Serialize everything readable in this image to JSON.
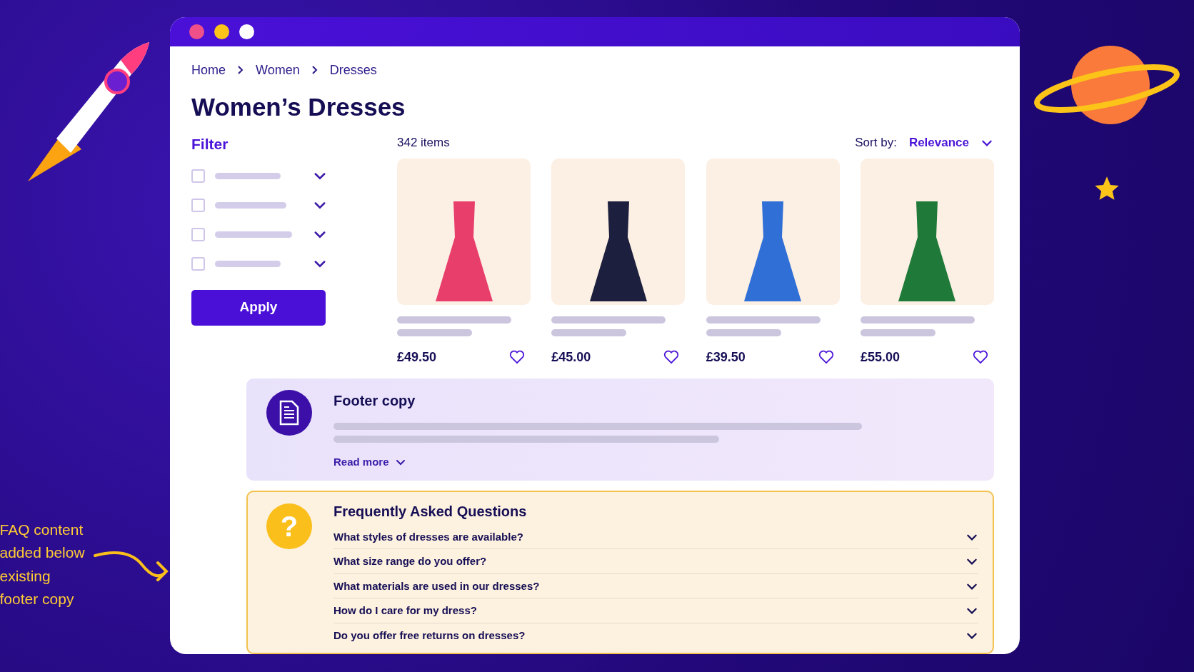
{
  "window": {
    "dots": [
      {
        "color": "#f0508a"
      },
      {
        "color": "#fcc419"
      },
      {
        "color": "#ffffff"
      }
    ]
  },
  "breadcrumb": [
    {
      "label": "Home"
    },
    {
      "label": "Women"
    },
    {
      "label": "Dresses"
    }
  ],
  "title": "Women’s Dresses",
  "filter": {
    "title": "Filter",
    "items": [
      {
        "checked": false
      },
      {
        "checked": false
      },
      {
        "checked": false
      },
      {
        "checked": false
      }
    ],
    "apply": "Apply"
  },
  "listing": {
    "count": "342 items",
    "sort_label": "Sort by:",
    "sort_value": "Relevance",
    "products": [
      {
        "price": "£49.50",
        "favorite": false,
        "color": "#e83e6c"
      },
      {
        "price": "£45.00",
        "favorite": false,
        "color": "#1c1f3d"
      },
      {
        "price": "£39.50",
        "favorite": false,
        "color": "#2f6fd6"
      },
      {
        "price": "£55.00",
        "favorite": false,
        "color": "#1f7a3a"
      }
    ]
  },
  "footer_copy": {
    "title": "Footer copy",
    "read_more": "Read more"
  },
  "faq": {
    "icon": "?",
    "title": "Frequently Asked Questions",
    "items": [
      {
        "question": "What styles of dresses are available?",
        "expanded": false
      },
      {
        "question": "What size range do you offer?",
        "expanded": false
      },
      {
        "question": "What materials are used in our dresses?",
        "expanded": false
      },
      {
        "question": "How do I care for my dress?",
        "expanded": false
      },
      {
        "question": "Do you offer free returns on dresses?",
        "expanded": false
      }
    ]
  },
  "annotation": {
    "text": "FAQ content added below existing footer copy"
  }
}
